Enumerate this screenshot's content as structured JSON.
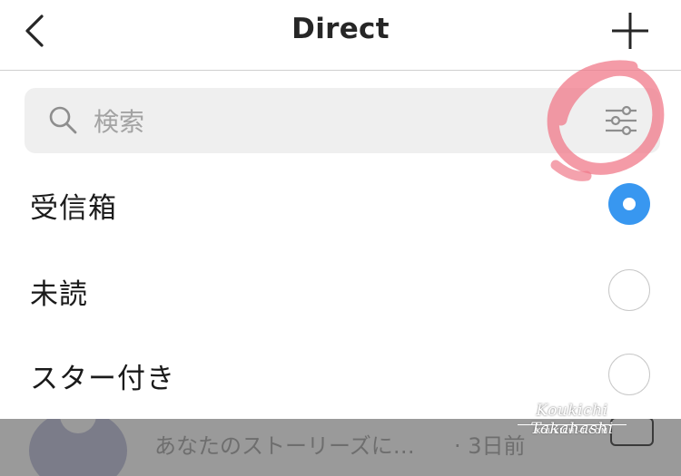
{
  "header": {
    "title": "Direct",
    "back_icon": "chevron-left-icon",
    "new_icon": "plus-icon"
  },
  "search": {
    "placeholder": "検索",
    "search_icon": "search-icon",
    "filter_icon": "sliders-icon"
  },
  "filter_options": [
    {
      "label": "受信箱",
      "selected": true
    },
    {
      "label": "未読",
      "selected": false
    },
    {
      "label": "スター付き",
      "selected": false
    }
  ],
  "background_list": {
    "preview_text": "あなたのストーリーズに…",
    "time_text": "· 3日前",
    "camera_icon": "camera-icon"
  },
  "annotation": {
    "color": "#f07a8a"
  },
  "watermark": {
    "name": "Koukichi Takahashi",
    "site": "KOUKICHI-T.COM"
  },
  "colors": {
    "accent": "#3897f0",
    "overlay": "#9a9a9a"
  }
}
